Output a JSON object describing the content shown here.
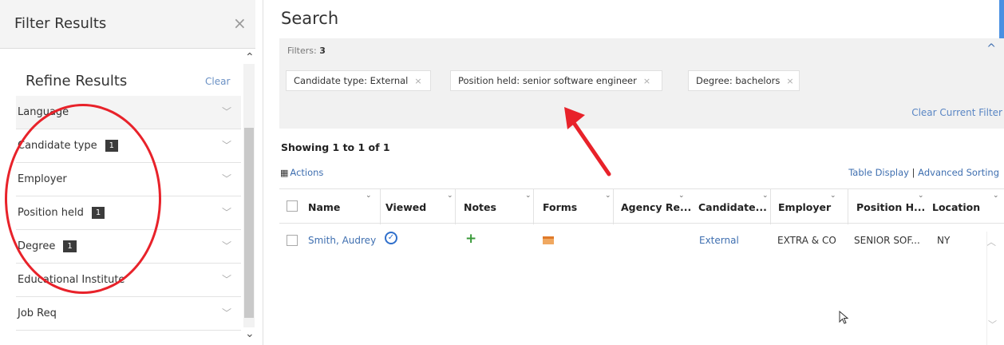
{
  "filter_panel": {
    "title": "Filter Results",
    "close_glyph": "×",
    "refine_title": "Refine Results",
    "clear_label": "Clear",
    "scroll_up_glyph": "⌃",
    "scroll_down_glyph": "⌄",
    "facets": [
      {
        "label": "Language",
        "badge": null
      },
      {
        "label": "Candidate type",
        "badge": "1"
      },
      {
        "label": "Employer",
        "badge": null
      },
      {
        "label": "Position held",
        "badge": "1"
      },
      {
        "label": "Degree",
        "badge": "1"
      },
      {
        "label": "Educational Institute",
        "badge": null
      },
      {
        "label": "Job Req",
        "badge": null
      }
    ]
  },
  "search": {
    "title": "Search",
    "filters_label": "Filters:",
    "filters_count": "3",
    "chips": [
      {
        "label": "Candidate type: External"
      },
      {
        "label": "Position held: senior software engineer"
      },
      {
        "label": "Degree: bachelors"
      }
    ],
    "chip_remove_glyph": "×",
    "clear_current_filter": "Clear Current Filter",
    "collapse_glyph": "^"
  },
  "results": {
    "showing": "Showing 1 to 1 of 1",
    "actions_label": "Actions",
    "table_display_label": "Table Display",
    "link_separator": "|",
    "advanced_sorting_label": "Advanced Sorting",
    "columns": [
      "Name",
      "Viewed",
      "Notes",
      "Forms",
      "Agency Re...",
      "Candidate...",
      "Employer",
      "Position H...",
      "Location"
    ],
    "rows": [
      {
        "name": "Smith, Audrey",
        "candidate_type": "External",
        "employer": "EXTRA & CO",
        "position": "SENIOR SOF...",
        "location": "NY"
      }
    ]
  },
  "icons": {
    "close": "close-icon",
    "viewed": "check-circle-icon",
    "notes": "plus-icon",
    "forms": "form-icon",
    "actions": "grid-icon"
  },
  "colors": {
    "link": "#3f6fb0",
    "annotation_red": "#e8222a",
    "badge_bg": "#3b3b3b",
    "filters_bg": "#f1f1f1"
  }
}
